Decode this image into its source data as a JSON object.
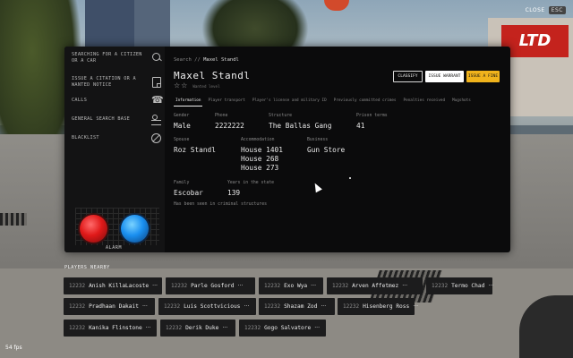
{
  "hud": {
    "close_label": "CLOSE",
    "close_key": "ESC",
    "fps": "54 fps"
  },
  "sidebar": {
    "items": [
      {
        "label": "SEARCHING FOR A CITIZEN OR A CAR",
        "icon": "search-icon"
      },
      {
        "label": "ISSUE A CITATION OR A WANTED NOTICE",
        "icon": "note-icon"
      },
      {
        "label": "CALLS",
        "icon": "phone-icon"
      },
      {
        "label": "GENERAL SEARCH BASE",
        "icon": "user-list-icon"
      },
      {
        "label": "BLACKLIST",
        "icon": "block-icon"
      }
    ],
    "alarm_label": "ALARM"
  },
  "breadcrumb": {
    "prefix": "Search //",
    "current": "Maxel Standl"
  },
  "profile": {
    "name": "Maxel Standl",
    "wanted_label": "Wanted level",
    "wanted_level": 0,
    "wanted_max": 2
  },
  "actions": {
    "classify": "CLASSIFY",
    "warrant": "ISSUE WARRANT",
    "fine": "ISSUE A FINE",
    "fine_color": "#f0b31c"
  },
  "tabs": [
    "Information",
    "Player transport",
    "Player's license and military ID",
    "Previously committed crimes",
    "Penalties received",
    "Mugshots"
  ],
  "active_tab": "Information",
  "fields": {
    "gender": {
      "label": "Gender",
      "value": "Male"
    },
    "phone": {
      "label": "Phone",
      "value": "2222222"
    },
    "structure": {
      "label": "Structure",
      "value": "The Ballas Gang"
    },
    "prison_terms": {
      "label": "Prison terms",
      "value": "41"
    },
    "spouse": {
      "label": "Spouse",
      "value": "Roz Standl"
    },
    "accommodation": {
      "label": "Accommodation",
      "values": [
        "House 1401",
        "House 268",
        "House 273"
      ]
    },
    "business": {
      "label": "Business",
      "value": "Gun Store"
    },
    "family": {
      "label": "Family",
      "value": "Escobar"
    },
    "years": {
      "label": "Years in the state",
      "value": "139"
    }
  },
  "note": "Has been seen in criminal structures",
  "players_nearby": {
    "title": "PLAYERS NEARBY",
    "players": [
      {
        "id": "12232",
        "name": "Anish KillaLacoste"
      },
      {
        "id": "12232",
        "name": "Parle Gosford"
      },
      {
        "id": "12232",
        "name": "Exo Wya"
      },
      {
        "id": "12232",
        "name": "Arven Affetmez"
      },
      {
        "id": "12232",
        "name": "Termo Chad"
      },
      {
        "id": "12232",
        "name": "Pradhaan Dakait"
      },
      {
        "id": "12232",
        "name": "Luis Scottvicious"
      },
      {
        "id": "12232",
        "name": "Shazam Zod"
      },
      {
        "id": "12232",
        "name": "Hisenberg Ross"
      },
      {
        "id": "12232",
        "name": "Kanika Flinstone"
      },
      {
        "id": "12232",
        "name": "Derik Duke"
      },
      {
        "id": "12232",
        "name": "Gogo Salvatore"
      }
    ],
    "more_glyph": "···"
  },
  "scene": {
    "store_sign": "LTD"
  }
}
